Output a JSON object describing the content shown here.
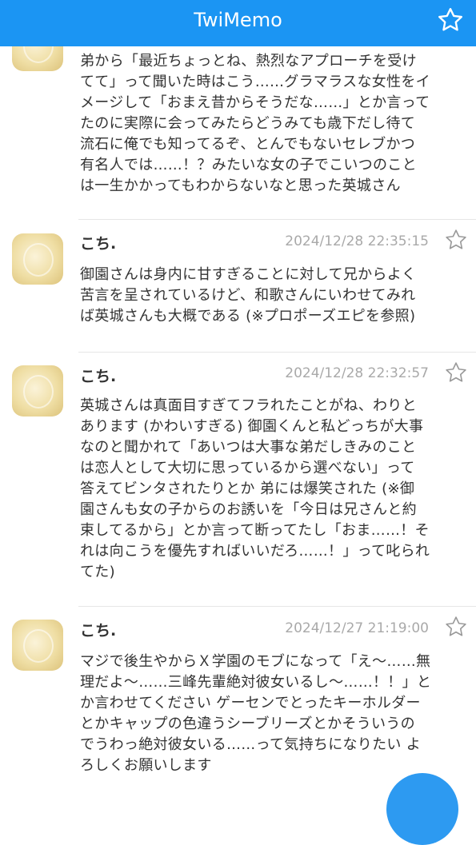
{
  "header": {
    "title": "TwiMemo",
    "star_icon": "star-outline-icon",
    "background": "#1b95f3"
  },
  "posts": [
    {
      "name": "",
      "date": "",
      "text": "弟から「最近ちょっとね、熱烈なアプローチを受け\nてて」って聞いた時はこう……グラマラスな女性をイ\nメージして「おまえ昔からそうだな……」とか言って\nたのに実際に会ってみたらどうみても歳下だし待て\n流石に俺でも知ってるぞ、とんでもないセレブかつ\n有名人では……！？みたいな女の子でこいつのこと\nは一生かかってもわからないなと思った英城さん"
    },
    {
      "name": "こち.",
      "date": "2024/12/28 22:35:15",
      "text": "御園さんは身内に甘すぎることに対して兄からよく\n苦言を呈されているけど、和歌さんにいわせてみれ\nば英城さんも大概である (※プロポーズエピを参照)"
    },
    {
      "name": "こち.",
      "date": "2024/12/28 22:32:57",
      "text": "英城さんは真面目すぎてフラれたことがね、わりと\nあります (かわいすぎる)  御園くんと私どっちが大事\nなのと聞かれて「あいつは大事な弟だしきみのこと\nは恋人として大切に思っているから選べない」って\n答えてビンタされたりとか  弟には爆笑された (※御\n園さんも女の子からのお誘いを「今日は兄さんと約\n束してるから」とか言って断ってたし「おま……！そ\nれは向こうを優先すればいいだろ……！」って叱られ\nてた)"
    },
    {
      "name": "こち.",
      "date": "2024/12/27 21:19:00",
      "text": "マジで後生やからＸ学園のモブになって「え〜……無\n理だよ〜……三峰先輩絶対彼女いるし〜……！！」と\nか言わせてください  ゲーセンでとったキーホルダー\nとかキャップの色違うシーブリーズとかそういうの\nでうわっ絶対彼女いる……って気持ちになりたい  よ\nろしくお願いします"
    }
  ]
}
